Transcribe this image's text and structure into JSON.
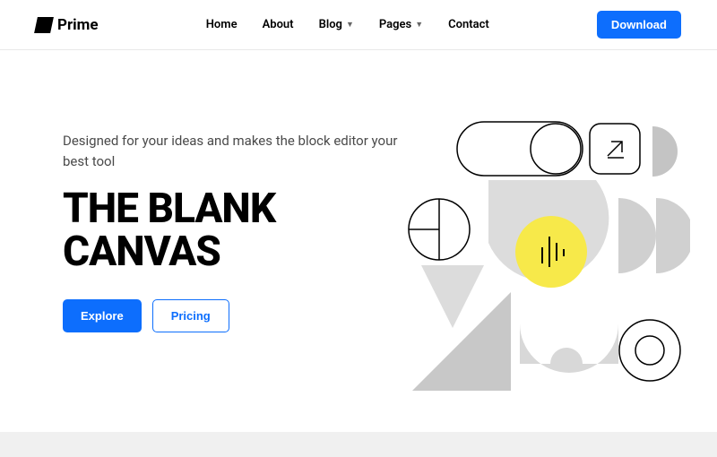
{
  "brand": {
    "name": "Prime"
  },
  "nav": {
    "items": [
      {
        "label": "Home",
        "dropdown": false
      },
      {
        "label": "About",
        "dropdown": false
      },
      {
        "label": "Blog",
        "dropdown": true
      },
      {
        "label": "Pages",
        "dropdown": true
      },
      {
        "label": "Contact",
        "dropdown": false
      }
    ]
  },
  "header": {
    "download_label": "Download"
  },
  "hero": {
    "subtitle": "Designed for your ideas and makes the block editor your best tool",
    "title": "THE BLANK CANVAS",
    "explore_label": "Explore",
    "pricing_label": "Pricing"
  },
  "colors": {
    "primary": "#0d6efd",
    "accent": "#f7e94a",
    "neutral": "#d9d9d9"
  }
}
